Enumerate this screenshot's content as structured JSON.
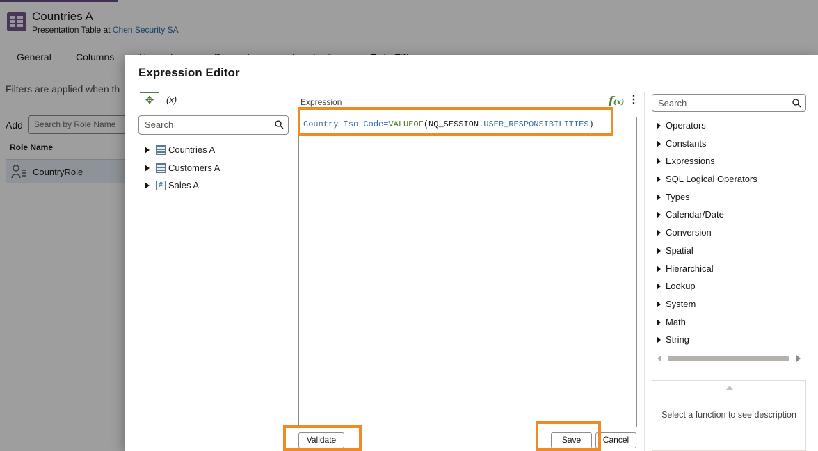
{
  "page": {
    "title": "Countries A",
    "subtitle_prefix": "Presentation Table at ",
    "subtitle_link": "Chen Security SA",
    "tabs": [
      "General",
      "Columns",
      "Hierarchies",
      "Descriptors",
      "Localization",
      "Data Filters"
    ],
    "filters_note": "Filters are applied when th",
    "add_label": "Add",
    "role_search_placeholder": "Search by Role Name",
    "role_column": "Role Name",
    "role_row": "CountryRole"
  },
  "dialog": {
    "title": "Expression Editor",
    "variables_label": "(x)",
    "left_search_placeholder": "Search",
    "tree": [
      {
        "label": "Countries A",
        "icon": "table-icon"
      },
      {
        "label": "Customers A",
        "icon": "table-icon"
      },
      {
        "label": "Sales A",
        "icon": "fact-table-icon"
      }
    ],
    "expression_label": "Expression",
    "expression": {
      "column": "Country Iso Code",
      "operator": "=",
      "function": "VALUEOF",
      "open": "(",
      "session": "NQ_SESSION.",
      "variable": "USER_RESPONSIBILITIES",
      "close": ")"
    },
    "fn_search_placeholder": "Search",
    "function_categories": [
      "Operators",
      "Constants",
      "Expressions",
      "SQL Logical Operators",
      "Types",
      "Calendar/Date",
      "Conversion",
      "Spatial",
      "Hierarchical",
      "Lookup",
      "System",
      "Math",
      "String"
    ],
    "description_placeholder": "Select a function to see description",
    "buttons": {
      "validate": "Validate",
      "save": "Save",
      "cancel": "Cancel"
    },
    "highlight_color": "#f08a24"
  }
}
